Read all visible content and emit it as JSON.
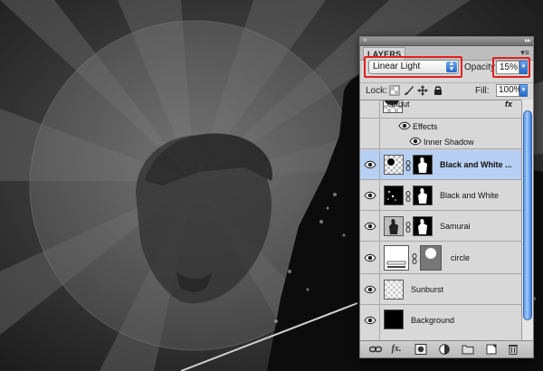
{
  "panel": {
    "tab_label": "LAYERS",
    "menu_glyph": "▾≡"
  },
  "blend": {
    "mode": "Linear Light",
    "opacity_label": "Opacity:",
    "opacity_value": "15%"
  },
  "lock": {
    "label": "Lock:",
    "fill_label": "Fill:",
    "fill_value": "100%"
  },
  "layers": [
    {
      "name": "cutout",
      "fx": "fx",
      "selected": false
    },
    {
      "name": "Effects"
    },
    {
      "name": "Inner Shadow"
    },
    {
      "name": "Black and White ...",
      "selected": true
    },
    {
      "name": "Black and White"
    },
    {
      "name": "Samurai"
    },
    {
      "name": "circle"
    },
    {
      "name": "Sunburst"
    },
    {
      "name": "Background"
    }
  ],
  "toolbar": {
    "icons": [
      "link-icon",
      "fx-icon",
      "mask-icon",
      "adjustment-icon",
      "group-icon",
      "new-layer-icon",
      "trash-icon"
    ],
    "fx_label": "fx."
  },
  "colors": {
    "highlight_red": "#e22020",
    "selected_row": "#b7cff2",
    "scroll_blue": "#5d9be8"
  }
}
